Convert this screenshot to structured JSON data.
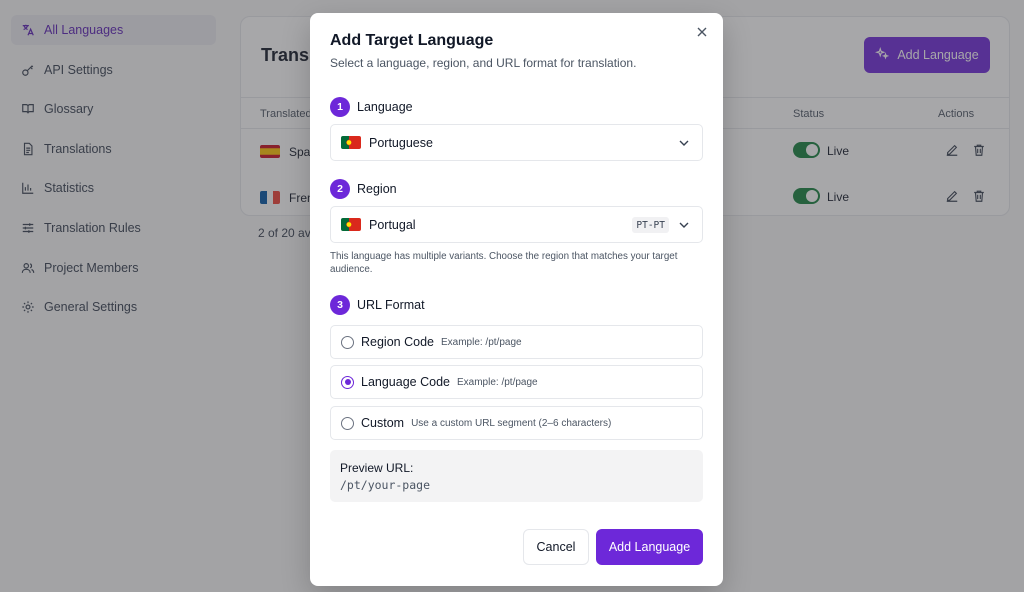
{
  "sidebar": {
    "items": [
      {
        "label": "All Languages",
        "icon": "translate-icon",
        "active": true
      },
      {
        "label": "API Settings",
        "icon": "key-icon"
      },
      {
        "label": "Glossary",
        "icon": "book-icon"
      },
      {
        "label": "Translations",
        "icon": "document-icon"
      },
      {
        "label": "Statistics",
        "icon": "bar-chart-icon"
      },
      {
        "label": "Translation Rules",
        "icon": "sliders-icon"
      },
      {
        "label": "Project Members",
        "icon": "users-icon"
      },
      {
        "label": "General Settings",
        "icon": "gear-icon"
      }
    ]
  },
  "main": {
    "title": "Transla",
    "add_button": "Add Language",
    "columns": {
      "translated": "Translated",
      "status": "Status",
      "actions": "Actions"
    },
    "rows": [
      {
        "name": "Spa",
        "status": "Live"
      },
      {
        "name": "Fren",
        "status": "Live"
      }
    ],
    "count": "2 of 20 av"
  },
  "modal": {
    "title": "Add Target Language",
    "subtitle": "Select a language, region, and URL format for translation.",
    "step1": {
      "num": "1",
      "label": "Language",
      "value": "Portuguese"
    },
    "step2": {
      "num": "2",
      "label": "Region",
      "value": "Portugal",
      "code": "PT-PT"
    },
    "region_hint": "This language has multiple variants. Choose the region that matches your target audience.",
    "step3": {
      "num": "3",
      "label": "URL Format"
    },
    "url_options": [
      {
        "label": "Region Code",
        "example": "Example: /pt/page",
        "selected": false
      },
      {
        "label": "Language Code",
        "example": "Example: /pt/page",
        "selected": true
      },
      {
        "label": "Custom",
        "example": "Use a custom URL segment (2–6 characters)",
        "selected": false
      }
    ],
    "preview": {
      "label": "Preview URL:",
      "value": "/pt/your-page"
    },
    "cancel": "Cancel",
    "submit": "Add Language"
  },
  "colors": {
    "accent": "#6d28d9",
    "live": "#15803d"
  }
}
